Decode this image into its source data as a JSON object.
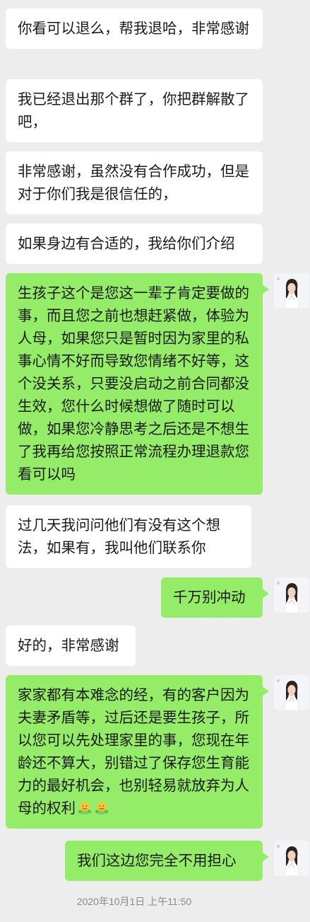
{
  "conversation": {
    "messages": [
      {
        "side": "in",
        "text": "你看可以退么，帮我退哈，非常感谢"
      },
      {
        "side": "in",
        "text": "我已经退出那个群了，你把群解散了吧，"
      },
      {
        "side": "in",
        "text": "非常感谢，虽然没有合作成功，但是对于你们我是很信任的，"
      },
      {
        "side": "in",
        "text": "如果身边有合适的，我给你们介绍"
      },
      {
        "side": "out",
        "text": "生孩子这个是您这一辈子肯定要做的事，而且您之前也想赶紧做，体验为人母，如果您只是暂时因为家里的私事心情不好而导致您情绪不好等，这个没关系，只要没启动之前合同都没生效，您什么时候想做了随时可以做，如果您冷静思考之后还是不想生了我再给您按照正常流程办理退款您看可以吗"
      },
      {
        "side": "in",
        "text": "过几天我问问他们有没有这个想法，如果有，我叫他们联系你"
      },
      {
        "side": "out",
        "text": "千万别冲动"
      },
      {
        "side": "in",
        "text": "好的，非常感谢"
      },
      {
        "side": "out",
        "text": "家家都有本难念的经，有的客户因为夫妻矛盾等，过后还是要生孩子，所以您可以先处理家里的事，您现在年龄还不算大，别错过了保存您生育能力的最好机会，也别轻易就放弃为人母的权利",
        "emoji": [
          "hugging-face-icon",
          "hugging-face-icon"
        ]
      },
      {
        "side": "out",
        "text": "我们这边您完全不用担心"
      }
    ],
    "timestamp": "2020年10月1日 上午11:50"
  },
  "colors": {
    "background": "#ededed",
    "incoming_bubble": "#ffffff",
    "outgoing_bubble": "#95ec69",
    "timestamp_text": "#8a8a8a"
  }
}
